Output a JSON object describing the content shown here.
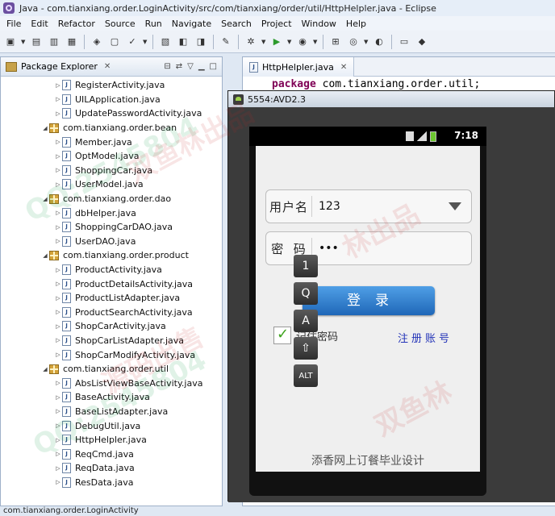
{
  "window": {
    "title": "Java - com.tianxiang.order.LoginActivity/src/com/tianxiang/order/util/HttpHelpler.java - Eclipse"
  },
  "menu": [
    "File",
    "Edit",
    "Refactor",
    "Source",
    "Run",
    "Navigate",
    "Search",
    "Project",
    "Window",
    "Help"
  ],
  "package_explorer": {
    "title": "Package Explorer",
    "close": "✕",
    "items": [
      {
        "kind": "file",
        "label": "RegisterActivity.java"
      },
      {
        "kind": "file",
        "label": "UILApplication.java"
      },
      {
        "kind": "file",
        "label": "UpdatePasswordActivity.java"
      },
      {
        "kind": "package",
        "label": "com.tianxiang.order.bean"
      },
      {
        "kind": "file",
        "label": "Member.java"
      },
      {
        "kind": "file",
        "label": "OptModel.java"
      },
      {
        "kind": "file",
        "label": "ShoppingCar.java"
      },
      {
        "kind": "file",
        "label": "UserModel.java"
      },
      {
        "kind": "package",
        "label": "com.tianxiang.order.dao"
      },
      {
        "kind": "file",
        "label": "dbHelper.java"
      },
      {
        "kind": "file",
        "label": "ShoppingCarDAO.java"
      },
      {
        "kind": "file",
        "label": "UserDAO.java"
      },
      {
        "kind": "package",
        "label": "com.tianxiang.order.product"
      },
      {
        "kind": "file",
        "label": "ProductActivity.java"
      },
      {
        "kind": "file",
        "label": "ProductDetailsActivity.java"
      },
      {
        "kind": "file",
        "label": "ProductListAdapter.java"
      },
      {
        "kind": "file",
        "label": "ProductSearchActivity.java"
      },
      {
        "kind": "file",
        "label": "ShopCarActivity.java"
      },
      {
        "kind": "file",
        "label": "ShopCarListAdapter.java"
      },
      {
        "kind": "file",
        "label": "ShopCarModifyActivity.java"
      },
      {
        "kind": "package",
        "label": "com.tianxiang.order.util"
      },
      {
        "kind": "file",
        "label": "AbsListViewBaseActivity.java"
      },
      {
        "kind": "file",
        "label": "BaseActivity.java"
      },
      {
        "kind": "file",
        "label": "BaseListAdapter.java"
      },
      {
        "kind": "file",
        "label": "DebugUtil.java"
      },
      {
        "kind": "file",
        "label": "HttpHelpler.java"
      },
      {
        "kind": "file",
        "label": "ReqCmd.java"
      },
      {
        "kind": "file",
        "label": "ReqData.java"
      },
      {
        "kind": "file",
        "label": "ResData.java"
      }
    ]
  },
  "editor": {
    "tab_label": "HttpHelpler.java",
    "tab_close": "✕",
    "code_keyword": "package",
    "code_rest": " com.tianxiang.order.util;"
  },
  "emulator": {
    "title": "5554:AVD2.3",
    "status_time": "7:18",
    "username_label": "用户名",
    "username_value": "123",
    "password_label": "密  码",
    "password_value": "•••",
    "login_button": "登录",
    "remember_checked": true,
    "remember_label": "记住密码",
    "register_link": "注册账号",
    "footer": "添香网上订餐毕业设计"
  },
  "keyboard_keys": [
    "1",
    "Q",
    "A",
    "⇧",
    "ALT"
  ],
  "statusbar": "com.tianxiang.order.LoginActivity",
  "watermark": [
    "QQ:2545804",
    "双鱼林出品",
    "源码出售",
    "林出品",
    "双鱼林"
  ],
  "colors": {
    "keyword": "#7f0055",
    "login_button": "#2a76c6",
    "register_link": "#2434b8",
    "checkbox_tick": "#3da31c"
  }
}
